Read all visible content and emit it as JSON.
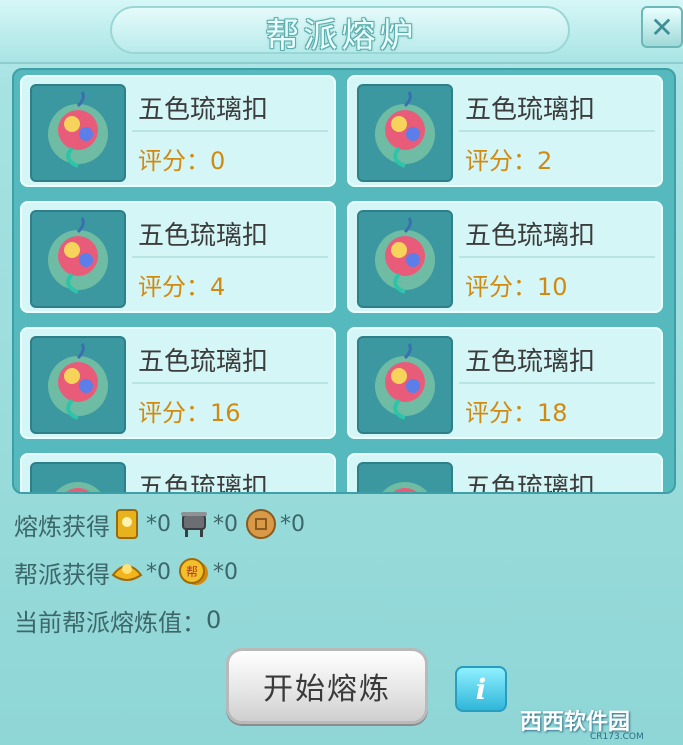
{
  "window": {
    "title": "帮派熔炉",
    "close_icon": "close-icon"
  },
  "items": [
    {
      "name": "五色琉璃扣",
      "score_label": "评分：",
      "score": "0"
    },
    {
      "name": "五色琉璃扣",
      "score_label": "评分：",
      "score": "2"
    },
    {
      "name": "五色琉璃扣",
      "score_label": "评分：",
      "score": "4"
    },
    {
      "name": "五色琉璃扣",
      "score_label": "评分：",
      "score": "10"
    },
    {
      "name": "五色琉璃扣",
      "score_label": "评分：",
      "score": "16"
    },
    {
      "name": "五色琉璃扣",
      "score_label": "评分：",
      "score": "18"
    },
    {
      "name": "五色琉璃扣",
      "score_label": "",
      "score": ""
    },
    {
      "name": "五色琉璃扣",
      "score_label": "",
      "score": ""
    }
  ],
  "smelt_rewards": {
    "label": "熔炼获得",
    "entries": [
      {
        "icon": "token-icon",
        "qty": "*0"
      },
      {
        "icon": "cauldron-icon",
        "qty": "*0"
      },
      {
        "icon": "coin-icon",
        "qty": "*0"
      }
    ]
  },
  "guild_rewards": {
    "label": "帮派获得",
    "entries": [
      {
        "icon": "gold-ingot-icon",
        "qty": "*0"
      },
      {
        "icon": "guild-coin-icon",
        "qty": "*0"
      }
    ]
  },
  "current_value": {
    "label": "当前帮派熔炼值：",
    "value": "0"
  },
  "buttons": {
    "start": "开始熔炼",
    "info": "i"
  },
  "watermark": {
    "text": "西西软件园",
    "sub": "CR173.COM"
  }
}
